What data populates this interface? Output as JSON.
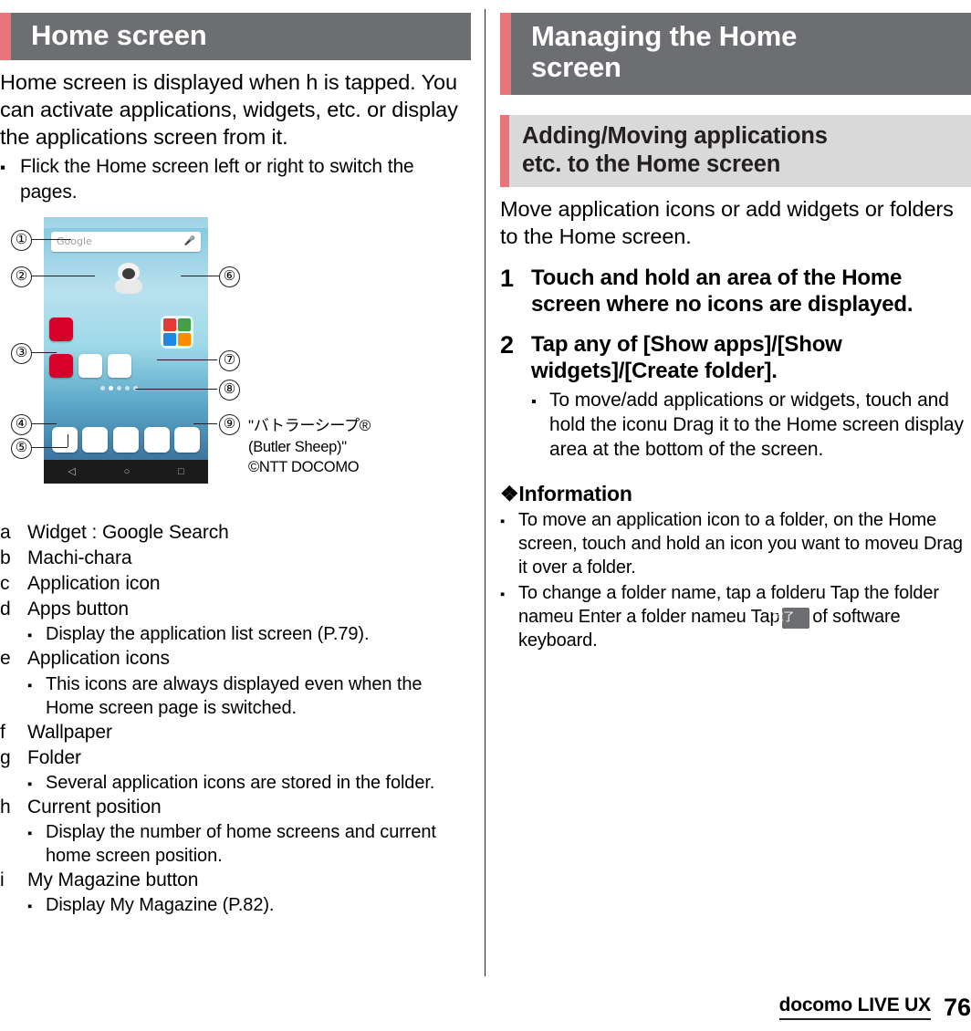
{
  "left": {
    "heading": "Home screen",
    "intro": "Home screen is displayed when h     is tapped. You can activate applications, widgets, etc. or display the applications screen from it.",
    "intro_bullet": "Flick the Home screen left or right to switch the pages.",
    "figure": {
      "callouts": [
        "①",
        "②",
        "③",
        "④",
        "⑤",
        "⑥",
        "⑦",
        "⑧",
        "⑨"
      ],
      "search_placeholder": "Google",
      "credit_line1": "\"バトラーシープ®",
      "credit_line2": "(Butler Sheep)\"",
      "credit_line3": "©NTT DOCOMO"
    },
    "legend": [
      {
        "key": "a",
        "text": "Widget : Google Search",
        "note": ""
      },
      {
        "key": "b",
        "text": "Machi-chara",
        "note": ""
      },
      {
        "key": "c",
        "text": "Application icon",
        "note": ""
      },
      {
        "key": "d",
        "text": "Apps button",
        "note": "Display the application list screen (P.79)."
      },
      {
        "key": "e",
        "text": "Application icons",
        "note": "This icons are always displayed even when the Home screen page is switched."
      },
      {
        "key": "f",
        "text": "Wallpaper",
        "note": ""
      },
      {
        "key": "g",
        "text": "Folder",
        "note": "Several application icons are stored in the folder."
      },
      {
        "key": "h",
        "text": "Current position",
        "note": "Display the number of home screens and current home screen position."
      },
      {
        "key": "i",
        "text": "My Magazine button",
        "note": "Display My Magazine (P.82)."
      }
    ]
  },
  "right": {
    "heading_line1": "Managing the Home",
    "heading_line2": "screen",
    "subheading_line1": "Adding/Moving applications",
    "subheading_line2": "etc. to the Home screen",
    "intro": "Move application icons or add widgets or folders to the Home screen.",
    "steps": [
      {
        "num": "1",
        "title": "Touch and hold an area of the Home screen where no icons are displayed.",
        "sub": ""
      },
      {
        "num": "2",
        "title": "Tap any of [Show apps]/[Show widgets]/[Create folder].",
        "sub": "To move/add applications or widgets, touch and hold the iconu Drag it to the Home screen display area at the bottom of the screen."
      }
    ],
    "information_heading": "❖Information",
    "information_items": [
      "To move an application icon to a folder, on the Home screen, touch and hold an icon you want to moveu Drag it over a folder.",
      "To change a folder name, tap a folderu Tap the folder nameu Enter a folder nameu Tap"
    ],
    "information_item2_keycap": "完了",
    "information_item2_tail": "of software keyboard."
  },
  "footer": {
    "label": "docomo LIVE UX",
    "page": "76"
  },
  "colors": {
    "heading_bg": "#6d6e71",
    "accent": "#e8747c",
    "subheading_bg": "#d9d9d9"
  }
}
